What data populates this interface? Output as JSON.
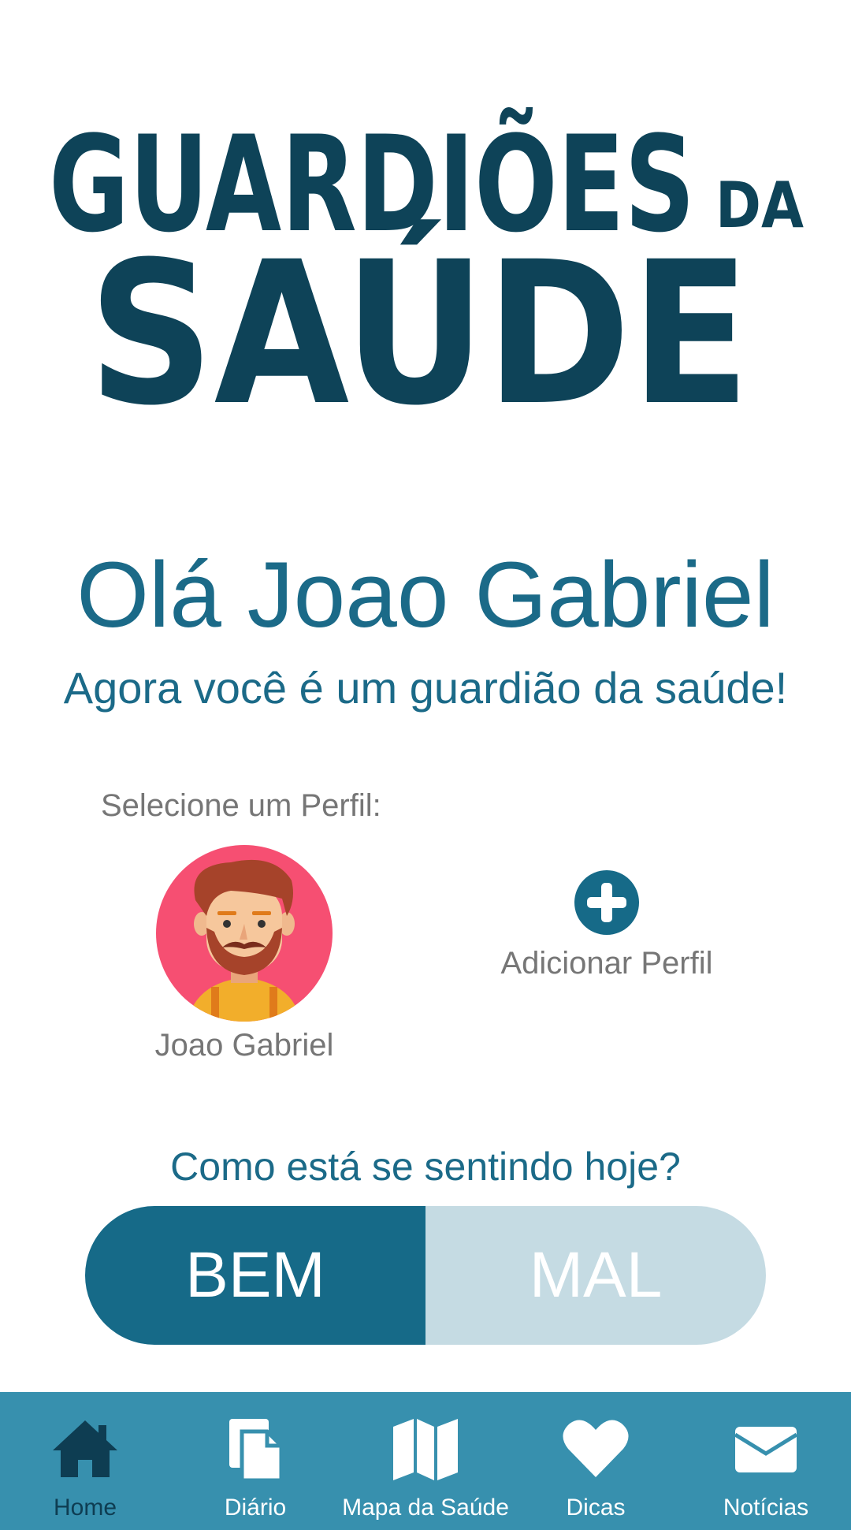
{
  "logo": {
    "line1": "GUARDIÕES",
    "small": "DA",
    "line2": "SAÚDE"
  },
  "greeting": "Olá Joao Gabriel",
  "subtitle": "Agora você é um guardião da saúde!",
  "profiles": {
    "select_label": "Selecione um Perfil:",
    "current_name": "Joao Gabriel",
    "add_label": "Adicionar Perfil"
  },
  "mood": {
    "question": "Como está se sentindo hoje?",
    "good_label": "BEM",
    "bad_label": "MAL",
    "selected": "BEM"
  },
  "nav": {
    "items": [
      {
        "label": "Home",
        "icon": "home-icon",
        "active": true
      },
      {
        "label": "Diário",
        "icon": "document-icon",
        "active": false
      },
      {
        "label": "Mapa da Saúde",
        "icon": "map-icon",
        "active": false
      },
      {
        "label": "Dicas",
        "icon": "heart-icon",
        "active": false
      },
      {
        "label": "Notícias",
        "icon": "mail-icon",
        "active": false
      }
    ]
  },
  "colors": {
    "brand_dark": "#0e4358",
    "brand": "#166a88",
    "nav_bg": "#3790ae",
    "mood_inactive": "#c5dbe3",
    "avatar_bg": "#f64f72"
  }
}
